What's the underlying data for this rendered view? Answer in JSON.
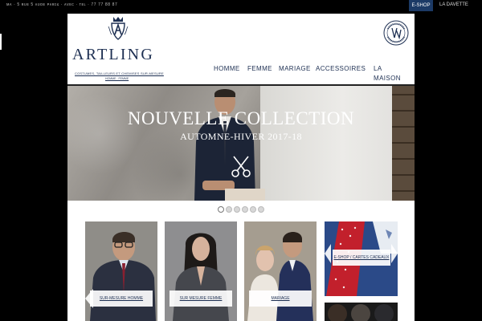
{
  "topbar": {
    "info": "ᴍᴀ · 5 ʀᴜᴇ 5 ᴀᴜᴅᴇ ᴘᴀʀɪꜱ · ᴀᴠᴇᴄ · ᴛᴇʟ · 77 77 88 87",
    "eshop_label": "E-SHOP",
    "ladavette_label": "LA DAVETTE"
  },
  "header": {
    "brand": "ARTLING",
    "tagline": "COSTUMES, TAILLEURS ET CHEMISES SUR-MESURE",
    "tagline2": "HOMME - FEMME",
    "seal_text": "LOUIS VUITTON · CITY GUIDE"
  },
  "nav": {
    "items": [
      "HOMME",
      "FEMME",
      "MARIAGE",
      "ACCESSOIRES",
      "LA",
      "MAISON"
    ]
  },
  "hero": {
    "title": "NOUVELLE COLLECTION",
    "subtitle": "AUTOMNE-HIVER 2017-18",
    "slides": 6,
    "active_slide": 1
  },
  "tiles": [
    {
      "label": "SUR-MESURE HOMME"
    },
    {
      "label": "SUR MESURE FEMME"
    },
    {
      "label": "MARIAGE"
    },
    {
      "label": "E-SHOP / CARTES CADEAUX"
    }
  ],
  "colors": {
    "navy": "#1d2f52",
    "eshop_bg": "#1c3a66"
  }
}
